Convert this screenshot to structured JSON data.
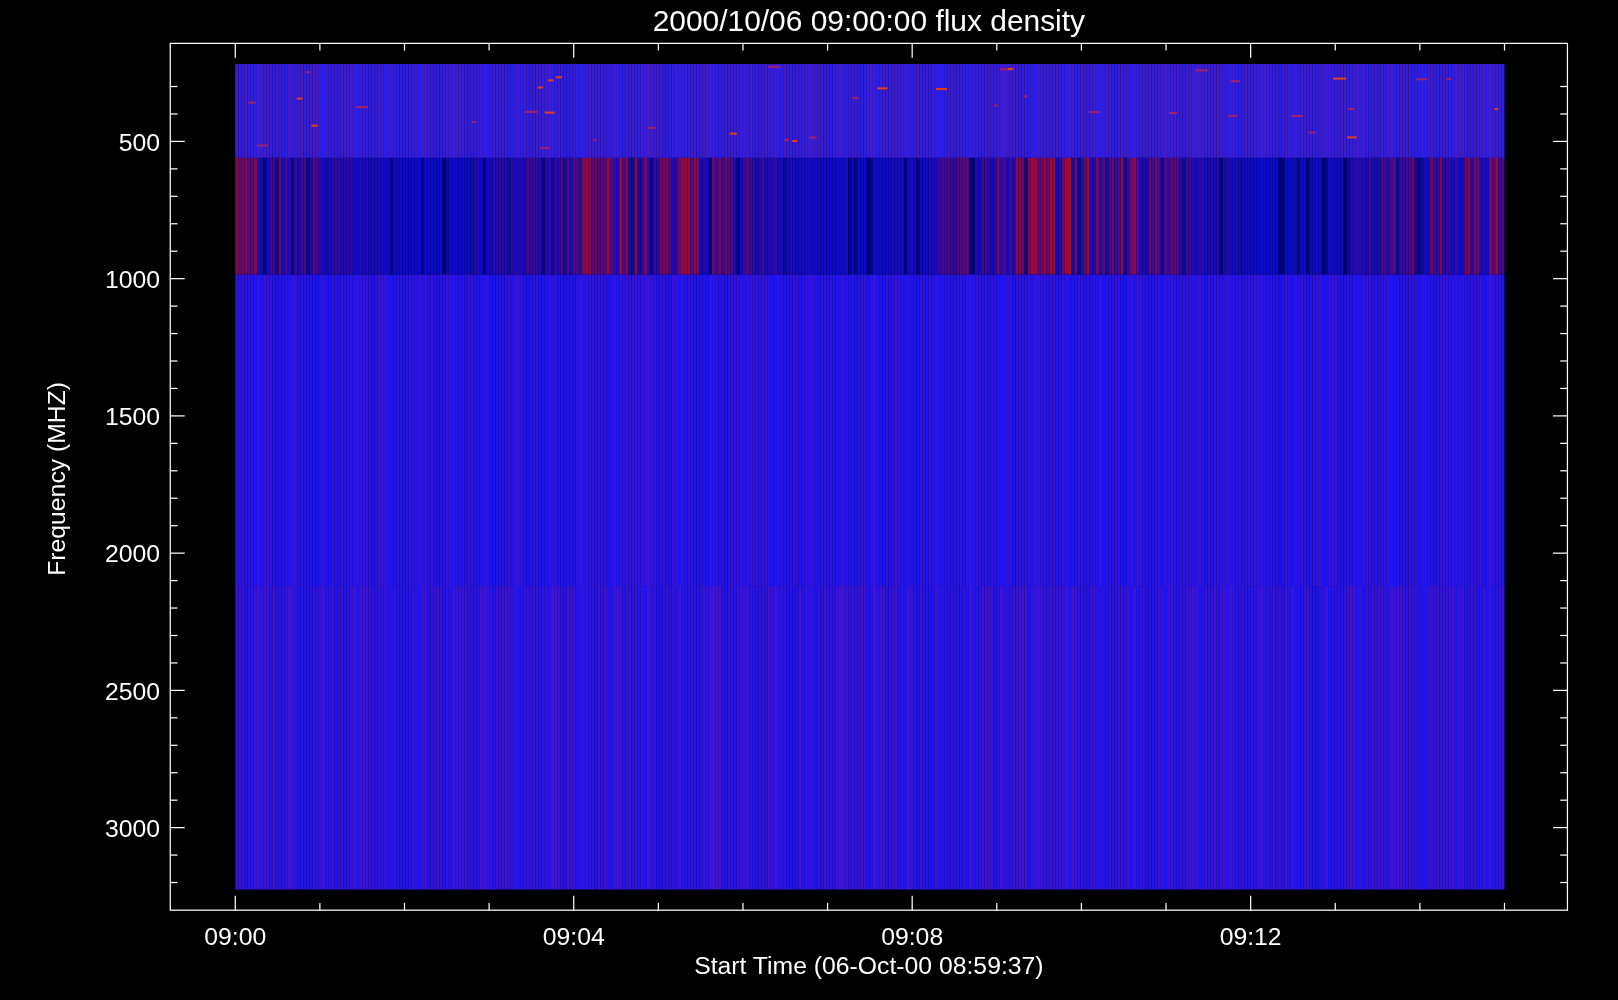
{
  "plot": {
    "title": "2000/10/06 09:00:00 flux density",
    "y_axis": {
      "label": "Frequency (MHZ)",
      "ticks": [
        "500",
        "1000",
        "1500",
        "2000",
        "2500",
        "3000"
      ]
    },
    "x_axis": {
      "label": "Start Time (06-Oct-00 08:59:37)",
      "ticks": [
        "09:00",
        "09:04",
        "09:08",
        "09:12"
      ]
    }
  }
}
